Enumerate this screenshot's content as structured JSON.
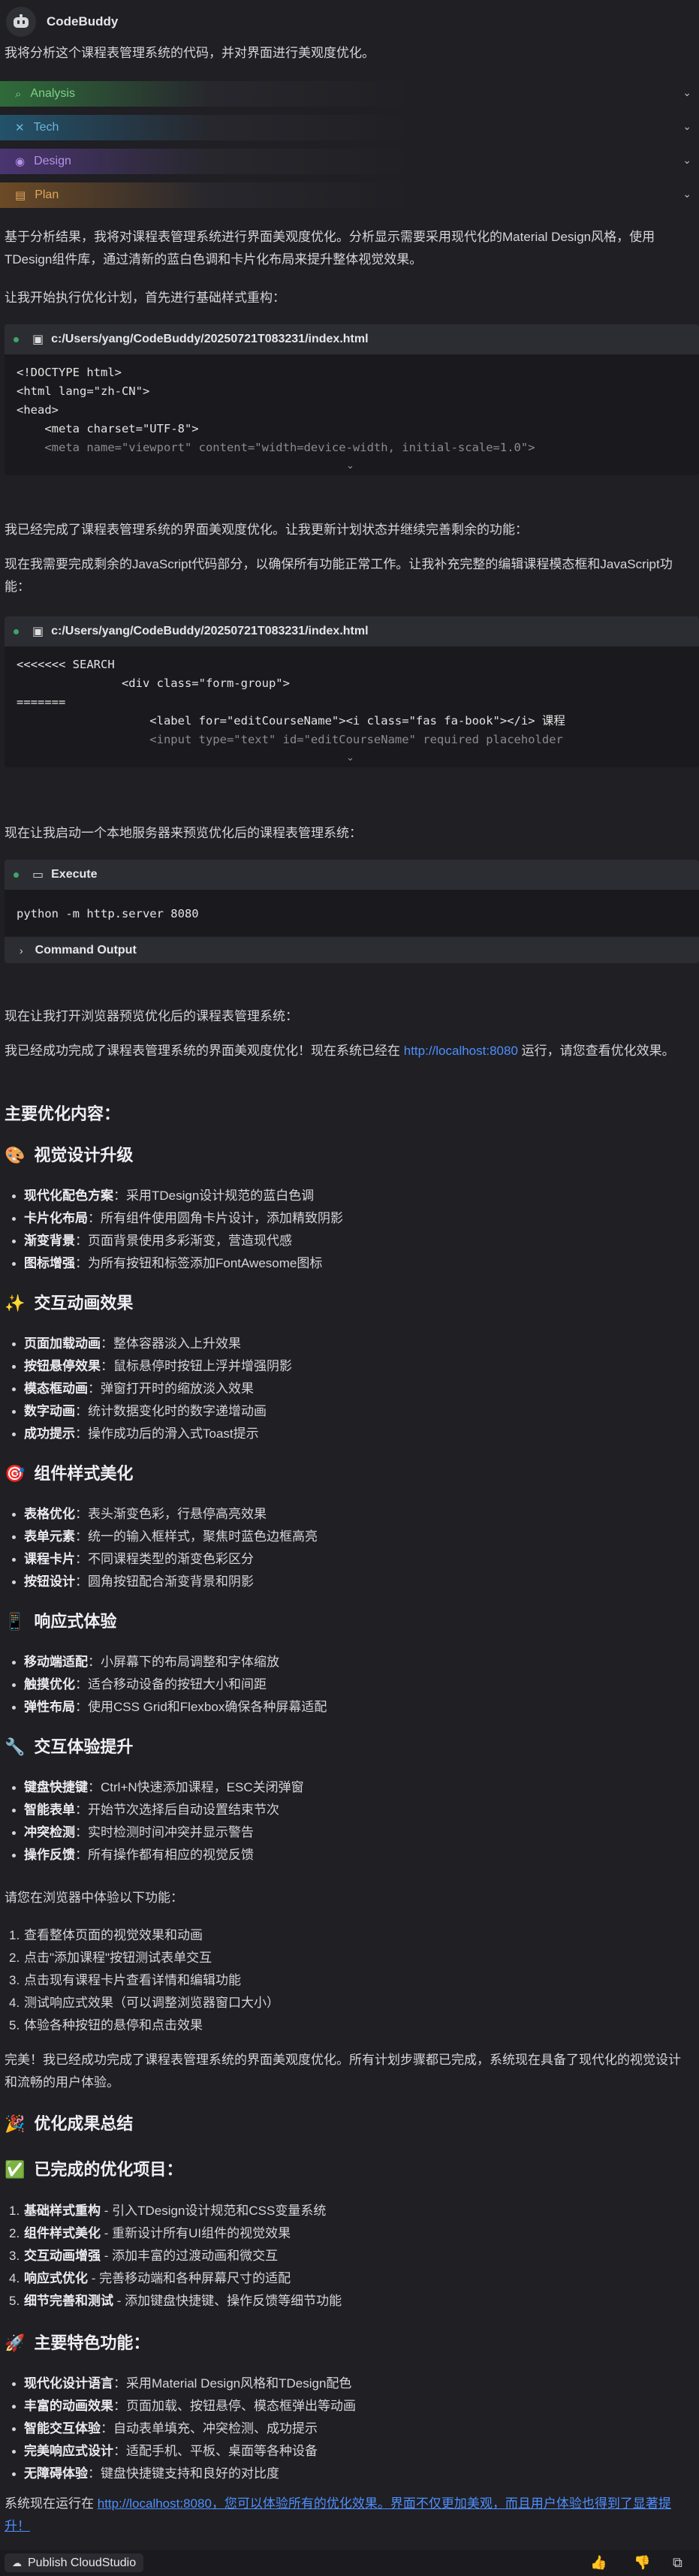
{
  "header": {
    "app_name": "CodeBuddy"
  },
  "intro": "我将分析这个课程表管理系统的代码，并对界面进行美观度优化。",
  "sections": [
    {
      "label": "Analysis",
      "icon": "search-icon",
      "glyph": "⌕",
      "color": "#2f6b3a",
      "text_color": "#7fd08a"
    },
    {
      "label": "Tech",
      "icon": "tools-icon",
      "glyph": "✕",
      "color": "#23526b",
      "text_color": "#6bb6dd"
    },
    {
      "label": "Design",
      "icon": "palette-icon",
      "glyph": "◉",
      "color": "#4a3570",
      "text_color": "#b493e6"
    },
    {
      "label": "Plan",
      "icon": "list-icon",
      "glyph": "▤",
      "color": "#6b4a26",
      "text_color": "#e0a65a"
    }
  ],
  "para1": "基于分析结果，我将对课程表管理系统进行界面美观度优化。分析显示需要采用现代化的Material Design风格，使用TDesign组件库，通过清新的蓝白色调和卡片化布局来提升整体视觉效果。",
  "para2": "让我开始执行优化计划，首先进行基础样式重构：",
  "code1": {
    "file": "c:/Users/yang/CodeBuddy/20250721T083231/index.html",
    "lines": [
      "<!DOCTYPE html>",
      "<html lang=\"zh-CN\">",
      "<head>",
      "    <meta charset=\"UTF-8\">",
      "    <meta name=\"viewport\" content=\"width=device-width, initial-scale=1.0\">"
    ]
  },
  "para3": "我已经完成了课程表管理系统的界面美观度优化。让我更新计划状态并继续完善剩余的功能：",
  "para4": "现在我需要完成剩余的JavaScript代码部分，以确保所有功能正常工作。让我补充完整的编辑课程模态框和JavaScript功能：",
  "code2": {
    "file": "c:/Users/yang/CodeBuddy/20250721T083231/index.html",
    "lines": [
      "<<<<<<< SEARCH",
      "               <div class=\"form-group\">",
      "=======",
      "                   <label for=\"editCourseName\"><i class=\"fas fa-book\"></i> 课程",
      "                   <input type=\"text\" id=\"editCourseName\" required placeholder"
    ]
  },
  "para5": "现在让我启动一个本地服务器来预览优化后的课程表管理系统：",
  "exec": {
    "title": "Execute",
    "command": "python -m http.server 8080",
    "output_label": "Command Output"
  },
  "para6": "现在让我打开浏览器预览优化后的课程表管理系统：",
  "para7_a": "我已经成功完成了课程表管理系统的界面美观度优化！现在系统已经在 ",
  "para7_link": "http://localhost:8080",
  "para7_b": " 运行，请您查看优化效果。",
  "main_title": "主要优化内容：",
  "groups": [
    {
      "emoji": "🎨",
      "title": "视觉设计升级",
      "items": [
        [
          "现代化配色方案",
          "：采用TDesign设计规范的蓝白色调"
        ],
        [
          "卡片化布局",
          "：所有组件使用圆角卡片设计，添加精致阴影"
        ],
        [
          "渐变背景",
          "：页面背景使用多彩渐变，营造现代感"
        ],
        [
          "图标增强",
          "：为所有按钮和标签添加FontAwesome图标"
        ]
      ]
    },
    {
      "emoji": "✨",
      "title": "交互动画效果",
      "items": [
        [
          "页面加载动画",
          "：整体容器淡入上升效果"
        ],
        [
          "按钮悬停效果",
          "：鼠标悬停时按钮上浮并增强阴影"
        ],
        [
          "模态框动画",
          "：弹窗打开时的缩放淡入效果"
        ],
        [
          "数字动画",
          "：统计数据变化时的数字递增动画"
        ],
        [
          "成功提示",
          "：操作成功后的滑入式Toast提示"
        ]
      ]
    },
    {
      "emoji": "🎯",
      "title": "组件样式美化",
      "items": [
        [
          "表格优化",
          "：表头渐变色彩，行悬停高亮效果"
        ],
        [
          "表单元素",
          "：统一的输入框样式，聚焦时蓝色边框高亮"
        ],
        [
          "课程卡片",
          "：不同课程类型的渐变色彩区分"
        ],
        [
          "按钮设计",
          "：圆角按钮配合渐变背景和阴影"
        ]
      ]
    },
    {
      "emoji": "📱",
      "title": "响应式体验",
      "items": [
        [
          "移动端适配",
          "：小屏幕下的布局调整和字体缩放"
        ],
        [
          "触摸优化",
          "：适合移动设备的按钮大小和间距"
        ],
        [
          "弹性布局",
          "：使用CSS Grid和Flexbox确保各种屏幕适配"
        ]
      ]
    },
    {
      "emoji": "🔧",
      "title": "交互体验提升",
      "items": [
        [
          "键盘快捷键",
          "：Ctrl+N快速添加课程，ESC关闭弹窗"
        ],
        [
          "智能表单",
          "：开始节次选择后自动设置结束节次"
        ],
        [
          "冲突检测",
          "：实时检测时间冲突并显示警告"
        ],
        [
          "操作反馈",
          "：所有操作都有相应的视觉反馈"
        ]
      ]
    }
  ],
  "try_intro": "请您在浏览器中体验以下功能：",
  "try_items": [
    "查看整体页面的视觉效果和动画",
    "点击\"添加课程\"按钮测试表单交互",
    "点击现有课程卡片查看详情和编辑功能",
    "测试响应式效果（可以调整浏览器窗口大小）",
    "体验各种按钮的悬停和点击效果"
  ],
  "done_para": "完美！我已经成功完成了课程表管理系统的界面美观度优化。所有计划步骤都已完成，系统现在具备了现代化的视觉设计和流畅的用户体验。",
  "summary_title": "优化成果总结",
  "summary_emoji": "🎉",
  "done_title": "已完成的优化项目：",
  "done_emoji": "✅",
  "done_items": [
    [
      "基础样式重构",
      " - 引入TDesign设计规范和CSS变量系统"
    ],
    [
      "组件样式美化",
      " - 重新设计所有UI组件的视觉效果"
    ],
    [
      "交互动画增强",
      " - 添加丰富的过渡动画和微交互"
    ],
    [
      "响应式优化",
      " - 完善移动端和各种屏幕尺寸的适配"
    ],
    [
      "细节完善和测试",
      " - 添加键盘快捷键、操作反馈等细节功能"
    ]
  ],
  "feature_title": "主要特色功能：",
  "feature_emoji": "🚀",
  "feature_items": [
    [
      "现代化设计语言",
      "：采用Material Design风格和TDesign配色"
    ],
    [
      "丰富的动画效果",
      "：页面加载、按钮悬停、模态框弹出等动画"
    ],
    [
      "智能交互体验",
      "：自动表单填充、冲突检测、成功提示"
    ],
    [
      "完美响应式设计",
      "：适配手机、平板、桌面等各种设备"
    ],
    [
      "无障碍体验",
      "：键盘快捷键支持和良好的对比度"
    ]
  ],
  "final_a": "系统现在运行在 ",
  "final_link": "http://localhost:8080，您可以体验所有的优化效果。界面不仅更加美观，而且用户体验也得到了显著提升！",
  "footer": {
    "publish_label": "Publish CloudStudio"
  }
}
